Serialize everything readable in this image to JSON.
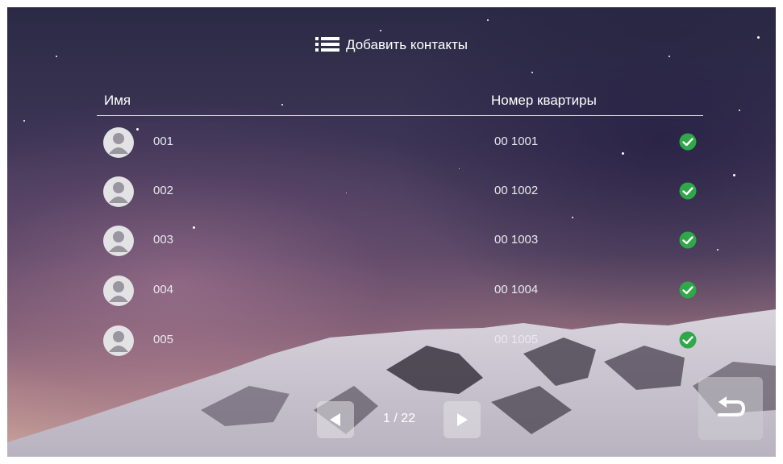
{
  "header": {
    "title": "Добавить контакты",
    "icon": "list-icon"
  },
  "table": {
    "columns": [
      "Имя",
      "Номер квартиры"
    ],
    "rows": [
      {
        "name": "001",
        "apartment": "00 1001",
        "selected": true
      },
      {
        "name": "002",
        "apartment": "00 1002",
        "selected": true
      },
      {
        "name": "003",
        "apartment": "00 1003",
        "selected": true
      },
      {
        "name": "004",
        "apartment": "00 1004",
        "selected": true
      },
      {
        "name": "005",
        "apartment": "00 1005",
        "selected": true
      }
    ]
  },
  "pager": {
    "text": "1 / 22",
    "prev_icon": "triangle-left-icon",
    "next_icon": "triangle-right-icon"
  },
  "back": {
    "icon": "return-arrow-icon"
  },
  "colors": {
    "check_green": "#2fa84a",
    "text": "#ffffff"
  }
}
